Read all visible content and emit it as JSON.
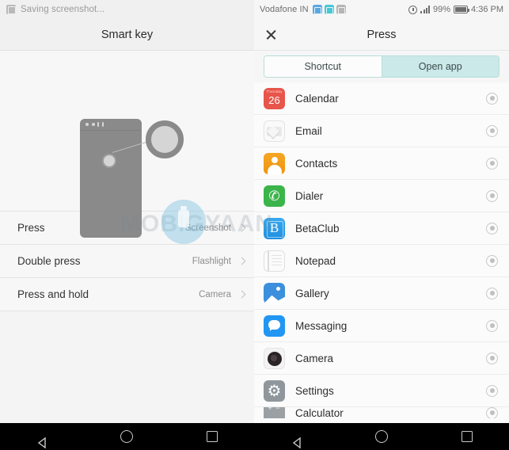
{
  "left": {
    "status": {
      "icon": "screenshot-icon",
      "text": "Saving screenshot..."
    },
    "title": "Smart key",
    "illustration": {
      "name": "phone-back-with-fingerprint-sensor-callout"
    },
    "rows": [
      {
        "label": "Press",
        "value": "Screenshot"
      },
      {
        "label": "Double press",
        "value": "Flashlight"
      },
      {
        "label": "Press and hold",
        "value": "Camera"
      }
    ],
    "watermark": "MOBIGYAAN"
  },
  "right": {
    "status": {
      "carrier": "Vodafone IN",
      "icons": [
        "sync-icon",
        "edit-icon",
        "screenshot-icon"
      ],
      "alarm": "alarm-icon",
      "signal": "signal-bars-icon",
      "battery_percent": "99%",
      "battery": "battery-icon",
      "time": "4:36 PM"
    },
    "header": {
      "close": "✕",
      "title": "Press"
    },
    "tabs": [
      {
        "label": "Shortcut",
        "selected": false
      },
      {
        "label": "Open app",
        "selected": true
      }
    ],
    "apps": [
      {
        "name": "Calendar",
        "icon": "calendar-icon",
        "selected": false,
        "day": "Thursday",
        "date": "26"
      },
      {
        "name": "Email",
        "icon": "email-icon",
        "selected": false
      },
      {
        "name": "Contacts",
        "icon": "contacts-icon",
        "selected": false
      },
      {
        "name": "Dialer",
        "icon": "dialer-icon",
        "selected": false
      },
      {
        "name": "BetaClub",
        "icon": "betaclub-icon",
        "selected": false
      },
      {
        "name": "Notepad",
        "icon": "notepad-icon",
        "selected": false
      },
      {
        "name": "Gallery",
        "icon": "gallery-icon",
        "selected": false
      },
      {
        "name": "Messaging",
        "icon": "messaging-icon",
        "selected": false
      },
      {
        "name": "Camera",
        "icon": "camera-icon",
        "selected": false
      },
      {
        "name": "Settings",
        "icon": "settings-icon",
        "selected": false
      },
      {
        "name": "Calculator",
        "icon": "calculator-icon",
        "selected": false
      }
    ]
  },
  "navbar": {
    "back": "back-icon",
    "home": "home-icon",
    "recents": "recents-icon"
  },
  "colors": {
    "tab_selected": "#cbe9e8",
    "tab_border": "#b8ddda",
    "calendar_red": "#e8554a",
    "contacts_orange": "#f5a623",
    "dialer_green": "#3bb44a",
    "messaging_blue": "#2196f3",
    "gallery_blue": "#3c8fdc",
    "settings_gray": "#8f979c",
    "navbar_black": "#000000"
  }
}
